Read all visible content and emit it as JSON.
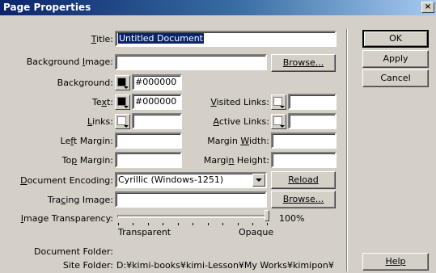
{
  "window": {
    "title": "Page Properties",
    "close_glyph": "×"
  },
  "labels": {
    "title": "Title:",
    "background_image": "Background Image:",
    "background": "Background:",
    "text": "Text:",
    "links": "Links:",
    "visited_links": "Visited Links:",
    "active_links": "Active Links:",
    "left_margin": "Left Margin:",
    "margin_width": "Margin Width:",
    "top_margin": "Top Margin:",
    "margin_height": "Margin Height:",
    "document_encoding": "Document Encoding:",
    "tracing_image": "Tracing Image:",
    "image_transparency": "Image Transparency:",
    "document_folder": "Document Folder:",
    "site_folder": "Site Folder:"
  },
  "values": {
    "title": "Untitled Document",
    "background_image": "",
    "background_color": "#000000",
    "text_color": "#000000",
    "links_color": "",
    "visited_links_color": "",
    "active_links_color": "",
    "left_margin": "",
    "margin_width": "",
    "top_margin": "",
    "margin_height": "",
    "document_encoding": "Cyrillic (Windows-1251)",
    "tracing_image": "",
    "document_folder": "",
    "site_folder": "D:¥kimi-books¥kimi-Lesson¥My Works¥kimipon¥"
  },
  "transparency": {
    "percent_label": "100%",
    "value": 100,
    "min_label": "Transparent",
    "max_label": "Opaque"
  },
  "buttons": {
    "ok": "OK",
    "apply": "Apply",
    "cancel": "Cancel",
    "help": "Help",
    "browse_bg": "Browse...",
    "reload": "Reload",
    "browse_tracing": "Browse..."
  },
  "colors": {
    "title_bar": "#0a246a",
    "background_swatch": "#000000",
    "text_swatch": "#000000"
  }
}
